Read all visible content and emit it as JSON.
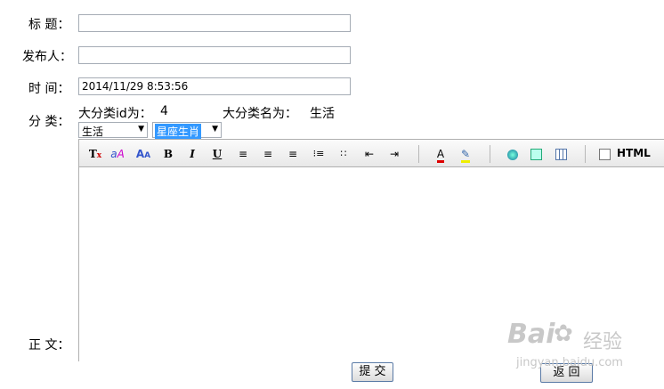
{
  "labels": {
    "title": "标 题：",
    "publisher": "发布人：",
    "time": "时 间：",
    "category": "分 类：",
    "body": "正 文："
  },
  "fields": {
    "title_value": "",
    "publisher_value": "",
    "time_value": "2014/11/29 8:53:56"
  },
  "category": {
    "big_id_label": "大分类id为：",
    "big_id_value": "4",
    "big_name_label": "大分类名为：",
    "big_name_value": "生活",
    "select_big": "生活",
    "select_small": "星座生肖"
  },
  "toolbar": {
    "icons": [
      "remove-format-icon",
      "font-name-icon",
      "font-size-icon",
      "bold-icon",
      "italic-icon",
      "underline-icon",
      "align-left-icon",
      "align-center-icon",
      "align-right-icon",
      "ordered-list-icon",
      "unordered-list-icon",
      "outdent-icon",
      "indent-icon",
      "font-color-icon",
      "highlight-icon",
      "link-icon",
      "image-icon",
      "table-icon"
    ],
    "html_label": "HTML"
  },
  "buttons": {
    "submit": "提 交",
    "back": "返 回"
  },
  "watermark": {
    "brand": "Bai",
    "brand2": "经验",
    "url": "jingyan.baidu.com"
  }
}
